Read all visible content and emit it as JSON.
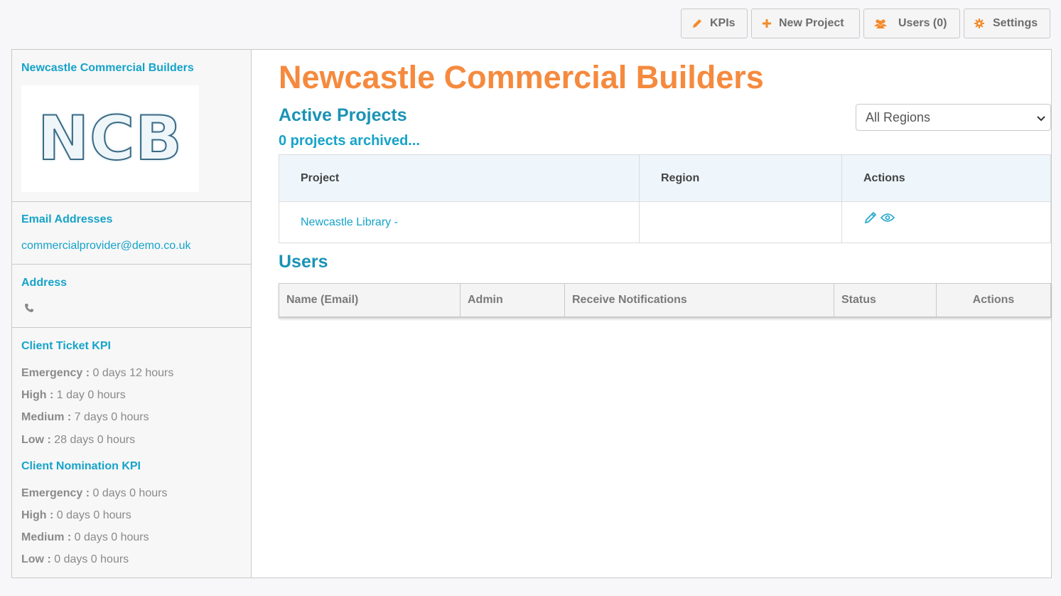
{
  "toolbar": {
    "kpis_label": "KPIs",
    "new_project_label": "New Project",
    "users_label": "Users (0)",
    "settings_label": "Settings"
  },
  "sidebar": {
    "company_name": "Newcastle Commercial Builders",
    "logo_text": "NCB",
    "email_title": "Email Addresses",
    "email": "commercialprovider@demo.co.uk",
    "address_title": "Address",
    "ticket_kpi": {
      "title": "Client Ticket KPI",
      "items": [
        {
          "label": "Emergency :",
          "value": "0 days 12 hours"
        },
        {
          "label": "High :",
          "value": "1 day 0 hours"
        },
        {
          "label": "Medium :",
          "value": "7 days 0 hours"
        },
        {
          "label": "Low :",
          "value": "28 days 0 hours"
        }
      ]
    },
    "nomination_kpi": {
      "title": "Client Nomination KPI",
      "items": [
        {
          "label": "Emergency :",
          "value": "0 days 0 hours"
        },
        {
          "label": "High :",
          "value": "0 days 0 hours"
        },
        {
          "label": "Medium :",
          "value": "0 days 0 hours"
        },
        {
          "label": "Low :",
          "value": "0 days 0 hours"
        }
      ]
    }
  },
  "main": {
    "title": "Newcastle Commercial Builders",
    "active_projects_heading": "Active Projects",
    "archived_link": "0 projects archived...",
    "region_filter": "All Regions",
    "projects_table": {
      "headers": [
        "Project",
        "Region",
        "Actions"
      ],
      "rows": [
        {
          "project": "Newcastle Library -",
          "region": ""
        }
      ]
    },
    "users_heading": "Users",
    "users_table": {
      "headers": [
        "Name (Email)",
        "Admin",
        "Receive Notifications",
        "Status",
        "Actions"
      ]
    }
  },
  "colors": {
    "accent_orange": "#f58a3e",
    "link_blue": "#16a3c9",
    "heading_teal": "#1a93b5"
  },
  "icons": {
    "kpis": "pencil-icon",
    "new_project": "plus-icon",
    "users": "users-icon",
    "settings": "gear-icon",
    "phone": "phone-icon",
    "edit": "pencil-icon",
    "view": "eye-icon"
  }
}
